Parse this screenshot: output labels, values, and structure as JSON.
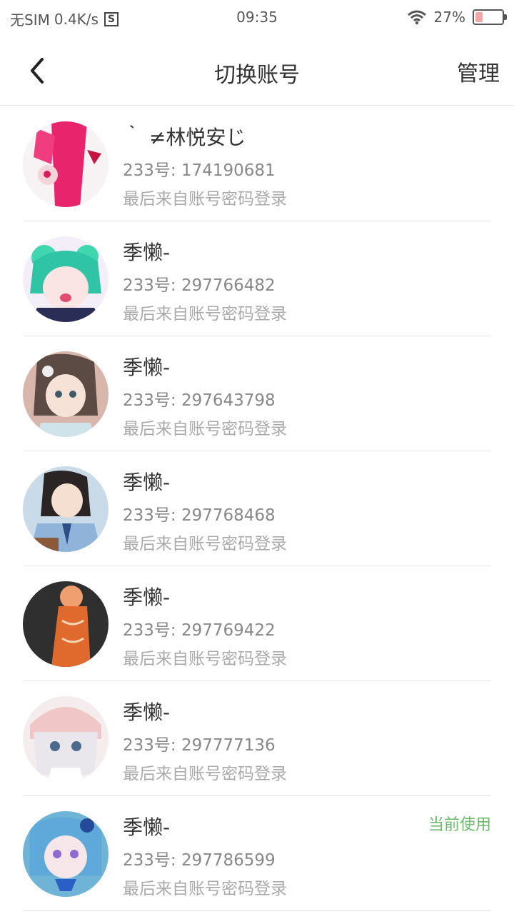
{
  "status_bar": {
    "carrier": "无SIM",
    "speed": "0.4K/s",
    "sim_badge": "S",
    "time": "09:35",
    "battery": "27%",
    "battery_level": 0.27
  },
  "header": {
    "title": "切换账号",
    "manage_label": "管理"
  },
  "accounts": [
    {
      "name": "｀ ≠林悦安じ",
      "id": "233号: 174190681",
      "login": "最后来自账号密码登录",
      "current": ""
    },
    {
      "name": "季懒-",
      "id": "233号: 297766482",
      "login": "最后来自账号密码登录",
      "current": ""
    },
    {
      "name": "季懒-",
      "id": "233号: 297643798",
      "login": "最后来自账号密码登录",
      "current": ""
    },
    {
      "name": "季懒-",
      "id": "233号: 297768468",
      "login": "最后来自账号密码登录",
      "current": ""
    },
    {
      "name": "季懒-",
      "id": "233号: 297769422",
      "login": "最后来自账号密码登录",
      "current": ""
    },
    {
      "name": "季懒-",
      "id": "233号: 297777136",
      "login": "最后来自账号密码登录",
      "current": ""
    },
    {
      "name": "季懒-",
      "id": "233号: 297786599",
      "login": "最后来自账号密码登录",
      "current": "当前使用"
    }
  ],
  "colors": {
    "current_badge": "#6dbb6d",
    "battery_fill": "#f2a6a6"
  }
}
